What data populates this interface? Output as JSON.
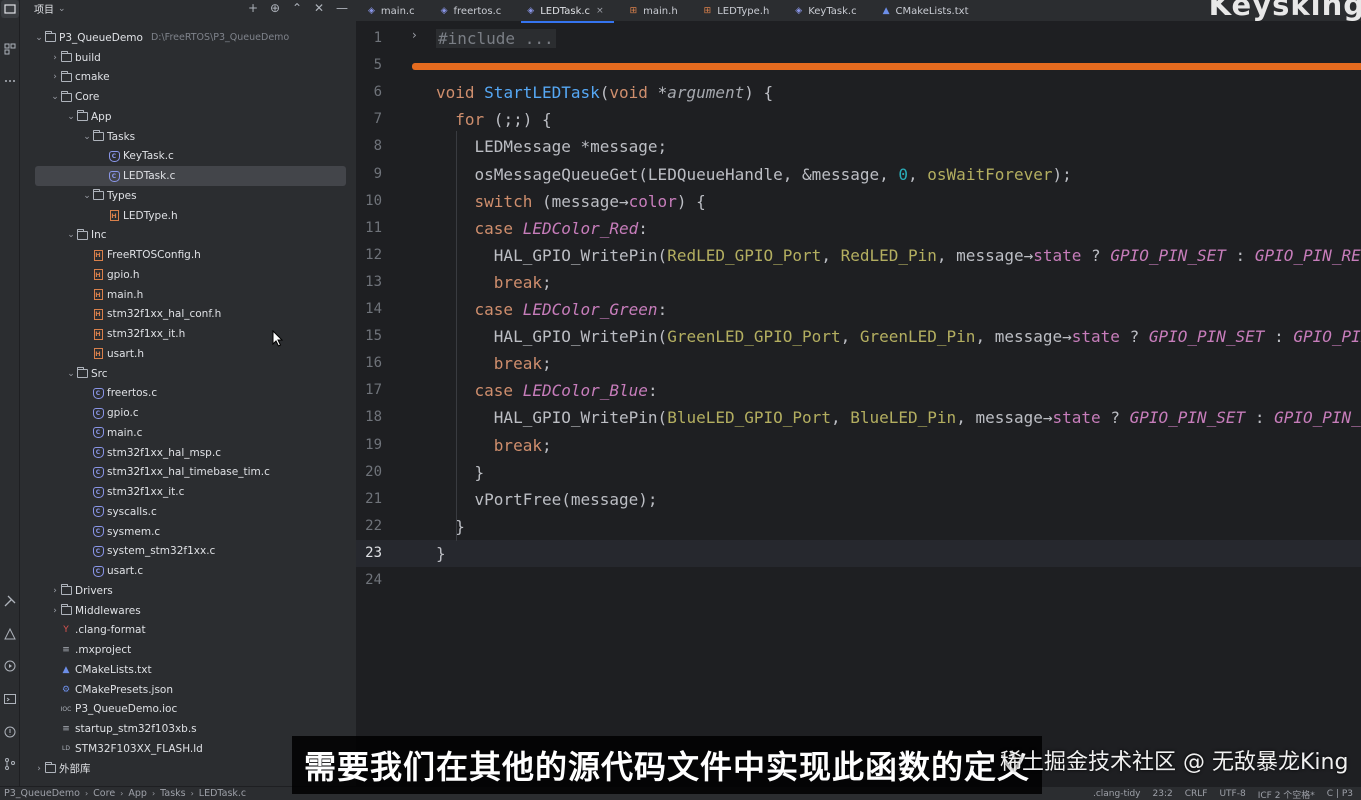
{
  "project_panel": {
    "title": "项目",
    "tools": [
      "+",
      "⊕",
      "⌃",
      "✕",
      "—"
    ],
    "tree": [
      {
        "label": "P3_QueueDemo",
        "hint": "D:\\FreeRTOS\\P3_QueueDemo",
        "depth": 0,
        "kind": "folder",
        "arrow": "⌄"
      },
      {
        "label": "build",
        "depth": 1,
        "kind": "folder",
        "arrow": "›"
      },
      {
        "label": "cmake",
        "depth": 1,
        "kind": "folder",
        "arrow": "›"
      },
      {
        "label": "Core",
        "depth": 1,
        "kind": "folder",
        "arrow": "⌄"
      },
      {
        "label": "App",
        "depth": 2,
        "kind": "folder",
        "arrow": "⌄"
      },
      {
        "label": "Tasks",
        "depth": 3,
        "kind": "folder",
        "arrow": "⌄"
      },
      {
        "label": "KeyTask.c",
        "depth": 4,
        "kind": "c"
      },
      {
        "label": "LEDTask.c",
        "depth": 4,
        "kind": "c",
        "selected": true
      },
      {
        "label": "Types",
        "depth": 3,
        "kind": "folder",
        "arrow": "⌄"
      },
      {
        "label": "LEDType.h",
        "depth": 4,
        "kind": "h"
      },
      {
        "label": "Inc",
        "depth": 2,
        "kind": "folder",
        "arrow": "⌄"
      },
      {
        "label": "FreeRTOSConfig.h",
        "depth": 3,
        "kind": "h"
      },
      {
        "label": "gpio.h",
        "depth": 3,
        "kind": "h"
      },
      {
        "label": "main.h",
        "depth": 3,
        "kind": "h"
      },
      {
        "label": "stm32f1xx_hal_conf.h",
        "depth": 3,
        "kind": "h"
      },
      {
        "label": "stm32f1xx_it.h",
        "depth": 3,
        "kind": "h"
      },
      {
        "label": "usart.h",
        "depth": 3,
        "kind": "h"
      },
      {
        "label": "Src",
        "depth": 2,
        "kind": "folder",
        "arrow": "⌄"
      },
      {
        "label": "freertos.c",
        "depth": 3,
        "kind": "c"
      },
      {
        "label": "gpio.c",
        "depth": 3,
        "kind": "c"
      },
      {
        "label": "main.c",
        "depth": 3,
        "kind": "c"
      },
      {
        "label": "stm32f1xx_hal_msp.c",
        "depth": 3,
        "kind": "c"
      },
      {
        "label": "stm32f1xx_hal_timebase_tim.c",
        "depth": 3,
        "kind": "c"
      },
      {
        "label": "stm32f1xx_it.c",
        "depth": 3,
        "kind": "c"
      },
      {
        "label": "syscalls.c",
        "depth": 3,
        "kind": "c"
      },
      {
        "label": "sysmem.c",
        "depth": 3,
        "kind": "c"
      },
      {
        "label": "system_stm32f1xx.c",
        "depth": 3,
        "kind": "c"
      },
      {
        "label": "usart.c",
        "depth": 3,
        "kind": "c"
      },
      {
        "label": "Drivers",
        "depth": 1,
        "kind": "folder",
        "arrow": "›"
      },
      {
        "label": "Middlewares",
        "depth": 1,
        "kind": "folder",
        "arrow": "›"
      },
      {
        "label": ".clang-format",
        "depth": 1,
        "kind": "misc",
        "glyph": "Y"
      },
      {
        "label": ".mxproject",
        "depth": 1,
        "kind": "misc",
        "glyph": "≡"
      },
      {
        "label": "CMakeLists.txt",
        "depth": 1,
        "kind": "misc",
        "glyph": "▲"
      },
      {
        "label": "CMakePresets.json",
        "depth": 1,
        "kind": "misc",
        "glyph": "⚙"
      },
      {
        "label": "P3_QueueDemo.ioc",
        "depth": 1,
        "kind": "misc",
        "glyph": "IOC"
      },
      {
        "label": "startup_stm32f103xb.s",
        "depth": 1,
        "kind": "misc",
        "glyph": "≡"
      },
      {
        "label": "STM32F103XX_FLASH.ld",
        "depth": 1,
        "kind": "misc",
        "glyph": "LD"
      },
      {
        "label": "外部库",
        "depth": 0,
        "kind": "lib",
        "arrow": "›"
      }
    ]
  },
  "tabs": [
    {
      "label": "main.c",
      "icon": "c-file-icon"
    },
    {
      "label": "freertos.c",
      "icon": "c-file-icon"
    },
    {
      "label": "LEDTask.c",
      "icon": "c-file-icon",
      "active": true,
      "close": "×"
    },
    {
      "label": "main.h",
      "icon": "h-file-icon"
    },
    {
      "label": "LEDType.h",
      "icon": "h-file-icon"
    },
    {
      "label": "KeyTask.c",
      "icon": "c-file-icon"
    },
    {
      "label": "CMakeLists.txt",
      "icon": "cmake-icon"
    }
  ],
  "watermark_top": "Keysking",
  "editor": {
    "current_line": 23,
    "line_numbers": [
      "1",
      "5",
      "6",
      "7",
      "8",
      "9",
      "10",
      "11",
      "12",
      "13",
      "14",
      "15",
      "16",
      "17",
      "18",
      "19",
      "20",
      "21",
      "22",
      "23",
      "24"
    ],
    "lines": [
      [
        {
          "t": "#include ...",
          "c": "incl"
        }
      ],
      [],
      [
        {
          "t": "void ",
          "c": "kw"
        },
        {
          "t": "StartLEDTask",
          "c": "fn"
        },
        {
          "t": "("
        },
        {
          "t": "void ",
          "c": "kw"
        },
        {
          "t": "*"
        },
        {
          "t": "argument",
          "c": "param"
        },
        {
          "t": ") {"
        }
      ],
      [
        {
          "t": "  "
        },
        {
          "t": "for",
          "c": "kw"
        },
        {
          "t": " (;;) {"
        }
      ],
      [
        {
          "t": "    LEDMessage *message;"
        }
      ],
      [
        {
          "t": "    osMessageQueueGet(LEDQueueHandle, &message, "
        },
        {
          "t": "0",
          "c": "num"
        },
        {
          "t": ", "
        },
        {
          "t": "osWaitForever",
          "c": "mac"
        },
        {
          "t": ");"
        }
      ],
      [
        {
          "t": "    "
        },
        {
          "t": "switch",
          "c": "kw"
        },
        {
          "t": " (message→"
        },
        {
          "t": "color",
          "c": "fld"
        },
        {
          "t": ") {"
        }
      ],
      [
        {
          "t": "    "
        },
        {
          "t": "case ",
          "c": "kw"
        },
        {
          "t": "LEDColor_Red",
          "c": "enum"
        },
        {
          "t": ":"
        }
      ],
      [
        {
          "t": "      HAL_GPIO_WritePin("
        },
        {
          "t": "RedLED_GPIO_Port",
          "c": "mac"
        },
        {
          "t": ", "
        },
        {
          "t": "RedLED_Pin",
          "c": "mac"
        },
        {
          "t": ", message→"
        },
        {
          "t": "state",
          "c": "fld"
        },
        {
          "t": " ? "
        },
        {
          "t": "GPIO_PIN_SET",
          "c": "enum"
        },
        {
          "t": " : "
        },
        {
          "t": "GPIO_PIN_RESET",
          "c": "enum"
        },
        {
          "t": ");"
        }
      ],
      [
        {
          "t": "      "
        },
        {
          "t": "break",
          "c": "kw"
        },
        {
          "t": ";"
        }
      ],
      [
        {
          "t": "    "
        },
        {
          "t": "case ",
          "c": "kw"
        },
        {
          "t": "LEDColor_Green",
          "c": "enum"
        },
        {
          "t": ":"
        }
      ],
      [
        {
          "t": "      HAL_GPIO_WritePin("
        },
        {
          "t": "GreenLED_GPIO_Port",
          "c": "mac"
        },
        {
          "t": ", "
        },
        {
          "t": "GreenLED_Pin",
          "c": "mac"
        },
        {
          "t": ", message→"
        },
        {
          "t": "state",
          "c": "fld"
        },
        {
          "t": " ? "
        },
        {
          "t": "GPIO_PIN_SET",
          "c": "enum"
        },
        {
          "t": " : "
        },
        {
          "t": "GPIO_PIN_RESET",
          "c": "enum"
        },
        {
          "t": ");"
        }
      ],
      [
        {
          "t": "      "
        },
        {
          "t": "break",
          "c": "kw"
        },
        {
          "t": ";"
        }
      ],
      [
        {
          "t": "    "
        },
        {
          "t": "case ",
          "c": "kw"
        },
        {
          "t": "LEDColor_Blue",
          "c": "enum"
        },
        {
          "t": ":"
        }
      ],
      [
        {
          "t": "      HAL_GPIO_WritePin("
        },
        {
          "t": "BlueLED_GPIO_Port",
          "c": "mac"
        },
        {
          "t": ", "
        },
        {
          "t": "BlueLED_Pin",
          "c": "mac"
        },
        {
          "t": ", message→"
        },
        {
          "t": "state",
          "c": "fld"
        },
        {
          "t": " ? "
        },
        {
          "t": "GPIO_PIN_SET",
          "c": "enum"
        },
        {
          "t": " : "
        },
        {
          "t": "GPIO_PIN_RESET",
          "c": "enum"
        },
        {
          "t": ");"
        }
      ],
      [
        {
          "t": "      "
        },
        {
          "t": "break",
          "c": "kw"
        },
        {
          "t": ";"
        }
      ],
      [
        {
          "t": "    }"
        }
      ],
      [
        {
          "t": "    vPortFree(message);"
        }
      ],
      [
        {
          "t": "  }"
        }
      ],
      [
        {
          "t": "}"
        }
      ],
      []
    ]
  },
  "status_bar": {
    "breadcrumb": [
      "P3_QueueDemo",
      "Core",
      "App",
      "Tasks",
      "LEDTask.c"
    ],
    "right": [
      ".clang-tidy",
      "23:2",
      "CRLF",
      "UTF-8",
      "ICF 2 个空格*",
      "C | P3"
    ]
  },
  "subtitle": "需要我们在其他的源代码文件中实现此函数的定义",
  "watermark_bottom": "稀土掘金技术社区 @ 无敌暴龙King",
  "colors": {
    "accent": "#3574f0",
    "breakpoint_bar": "#e56b1f",
    "keyword": "#cf8e6d",
    "function": "#56a8f5",
    "enum_constant": "#c77dbb",
    "macro": "#b3ae60",
    "number": "#2aacb8"
  }
}
